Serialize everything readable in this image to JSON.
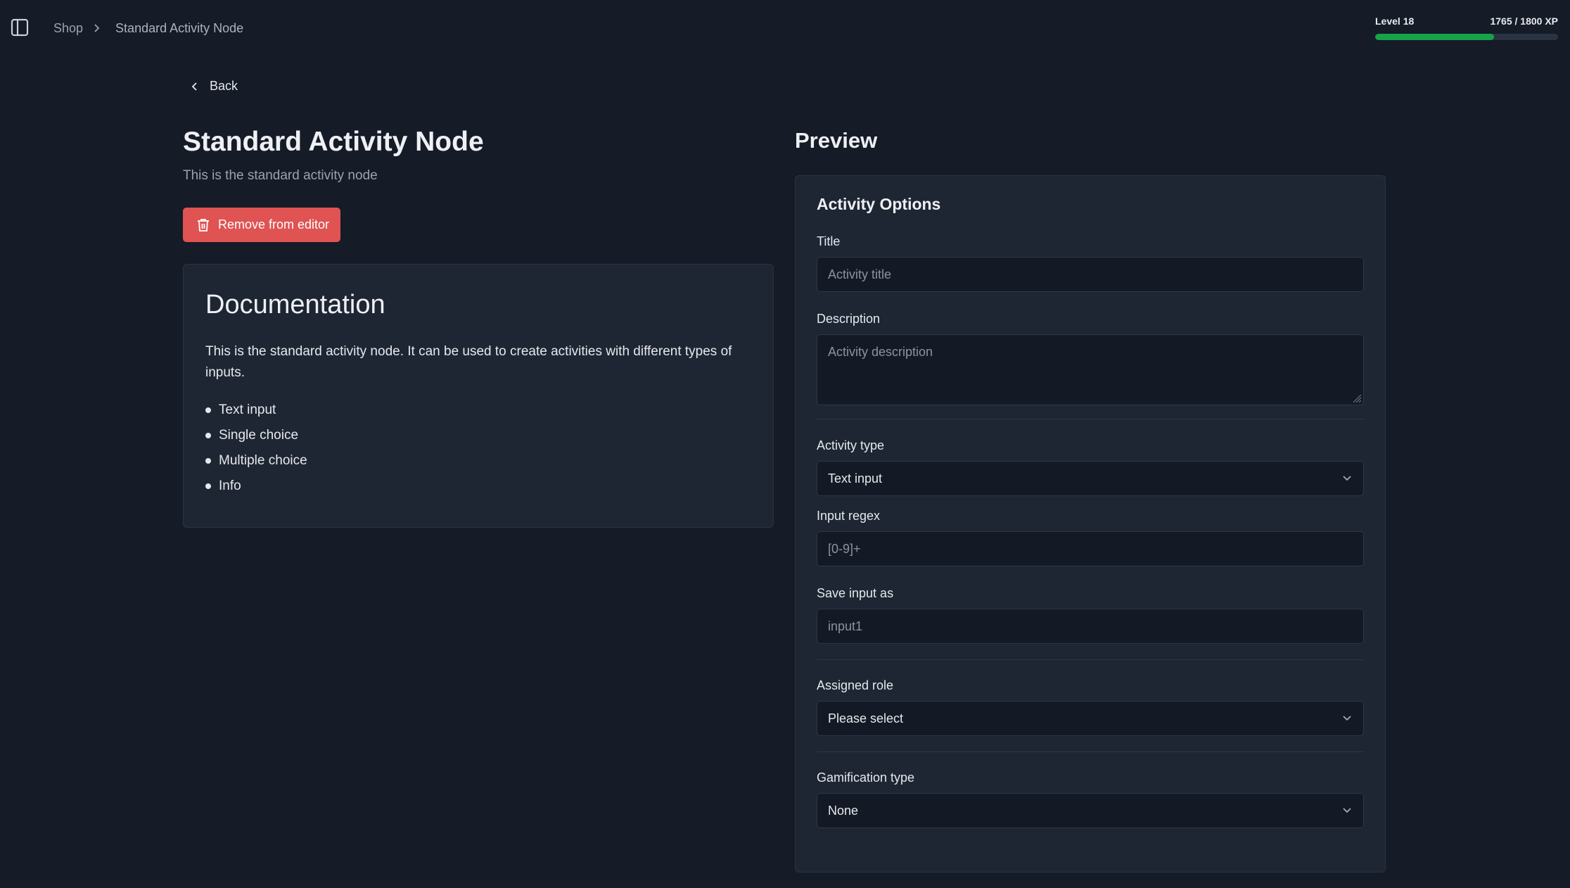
{
  "breadcrumb": {
    "items": [
      "Shop",
      "Standard Activity Node"
    ]
  },
  "xp": {
    "level_label": "Level 18",
    "xp_label": "1765 / 1800 XP",
    "progress": 0.65
  },
  "back_label": "Back",
  "page": {
    "title": "Standard Activity Node",
    "subtitle": "This is the standard activity node",
    "remove_button_label": "Remove from editor"
  },
  "documentation": {
    "title": "Documentation",
    "text": "This is the standard activity node. It can be used to create activities with different types of inputs.",
    "items": [
      "Text input",
      "Single choice",
      "Multiple choice",
      "Info"
    ]
  },
  "preview": {
    "title": "Preview",
    "heading": "Activity Options",
    "title_field": {
      "label": "Title",
      "placeholder": "Activity title"
    },
    "description_field": {
      "label": "Description",
      "placeholder": "Activity description"
    },
    "activity_type": {
      "label": "Activity type",
      "value": "Text input"
    },
    "input_regex": {
      "label": "Input regex",
      "placeholder": "[0-9]+"
    },
    "save_input_as": {
      "label": "Save input as",
      "placeholder": "input1"
    },
    "assigned_role": {
      "label": "Assigned role",
      "value": "Please select"
    },
    "gamification_type": {
      "label": "Gamification type",
      "value": "None"
    }
  },
  "colors": {
    "background": "#151b27",
    "card": "#1e2634",
    "danger": "#e05353",
    "xp_fill": "#16a34a"
  }
}
